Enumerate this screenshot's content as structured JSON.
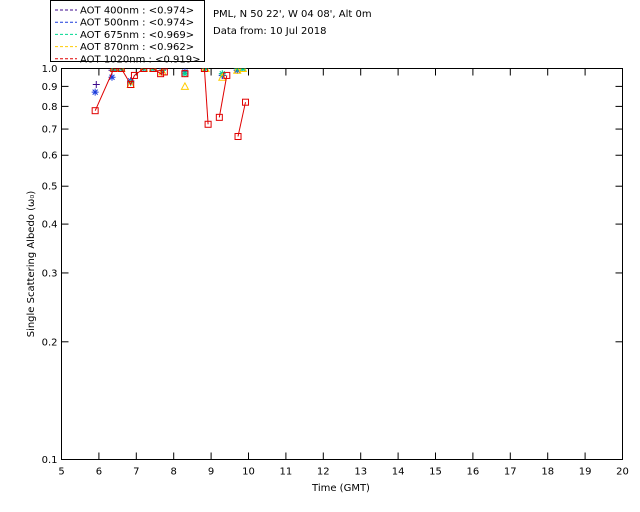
{
  "site_info": {
    "location": "PML, N 50 22', W 04 08', Alt 0m",
    "data_date": "Data from: 10 Jul 2018"
  },
  "chart_data": {
    "type": "scatter",
    "xlabel": "Time (GMT)",
    "ylabel": "Single Scattering Albedo (ω₀)",
    "xlim": [
      5,
      20
    ],
    "ylim": [
      0.1,
      1.0
    ],
    "yscale": "log",
    "x_ticks": [
      5,
      6,
      7,
      8,
      9,
      10,
      11,
      12,
      13,
      14,
      15,
      16,
      17,
      18,
      19,
      20
    ],
    "y_ticks": [
      0.1,
      0.2,
      0.3,
      0.4,
      0.5,
      0.6,
      0.7,
      0.8,
      0.9,
      1.0
    ],
    "y_tick_labels": [
      "0.1",
      "0.2",
      "0.3",
      "0.4",
      "0.5",
      "0.6",
      "0.7",
      "0.8",
      "0.9",
      "1.0"
    ],
    "grid": false,
    "legend_position": "top-left",
    "series": [
      {
        "name": "AOT  400nm : <0.974>",
        "color": "#3d0a8c",
        "marker": "plus",
        "x": [
          5.93,
          6.35,
          6.45,
          6.6,
          6.85,
          7.2,
          7.45,
          7.7,
          8.3,
          8.85,
          9.3,
          9.7,
          9.85
        ],
        "y": [
          0.91,
          0.99,
          1.0,
          1.0,
          0.93,
          1.0,
          1.0,
          1.0,
          0.98,
          1.0,
          0.96,
          0.99,
          1.0
        ],
        "segments": []
      },
      {
        "name": "AOT  500nm : <0.974>",
        "color": "#1a3cdc",
        "marker": "asterisk",
        "x": [
          5.9,
          6.35,
          6.45,
          6.6,
          6.85,
          7.2,
          7.45,
          7.7,
          8.3,
          8.85,
          9.3,
          9.7,
          9.85
        ],
        "y": [
          0.87,
          0.95,
          1.0,
          1.0,
          0.93,
          1.0,
          1.0,
          0.99,
          0.98,
          1.0,
          0.96,
          0.99,
          1.0
        ],
        "segments": []
      },
      {
        "name": "AOT  675nm : <0.969>",
        "color": "#00d890",
        "marker": "asterisk",
        "x": [
          6.4,
          6.6,
          6.85,
          7.2,
          7.45,
          7.7,
          8.3,
          8.85,
          9.3,
          9.7,
          9.85
        ],
        "y": [
          1.0,
          1.0,
          0.92,
          1.0,
          1.0,
          0.99,
          0.97,
          1.0,
          0.97,
          1.0,
          1.0
        ],
        "segments": []
      },
      {
        "name": "AOT  870nm : <0.962>",
        "color": "#ffcc00",
        "marker": "triangle",
        "x": [
          6.4,
          6.6,
          6.85,
          7.2,
          7.45,
          7.7,
          8.3,
          8.85,
          9.3,
          9.7,
          9.85
        ],
        "y": [
          1.0,
          1.0,
          0.91,
          1.0,
          1.0,
          0.98,
          0.9,
          1.0,
          0.95,
          0.99,
          1.0
        ],
        "segments": []
      },
      {
        "name": "AOT 1020nm : <0.919>",
        "color": "#e00000",
        "marker": "square",
        "x": [
          5.9,
          6.4,
          6.6,
          6.85,
          6.95,
          7.2,
          7.45,
          7.65,
          7.75,
          8.3,
          8.82,
          8.92,
          9.22,
          9.42,
          9.72,
          9.92
        ],
        "y": [
          0.78,
          1.0,
          1.0,
          0.91,
          0.96,
          1.0,
          1.0,
          0.97,
          0.98,
          0.97,
          1.0,
          0.72,
          0.75,
          0.96,
          0.67,
          0.82
        ],
        "segments": [
          [
            0,
            1,
            2,
            3,
            4,
            5,
            6,
            7,
            8
          ],
          [
            9
          ],
          [
            10,
            11
          ],
          [
            12,
            13
          ],
          [
            14,
            15
          ]
        ]
      }
    ]
  }
}
